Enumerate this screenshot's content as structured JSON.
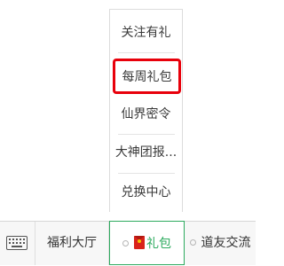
{
  "popup": {
    "items": [
      {
        "label": "关注有礼"
      },
      {
        "label": "每周礼包"
      },
      {
        "label": "仙界密令"
      },
      {
        "label": "大神团报..."
      },
      {
        "label": "兑换中心"
      }
    ],
    "highlight_color": "#e8000b"
  },
  "menubar": {
    "keyboard_icon": "keyboard-icon",
    "items": [
      {
        "label": "福利大厅",
        "active": false
      },
      {
        "label": "礼包",
        "active": true,
        "icon": "red-envelope-icon"
      },
      {
        "label": "道友交流",
        "active": false
      }
    ],
    "accent_color": "#2eab5f"
  }
}
